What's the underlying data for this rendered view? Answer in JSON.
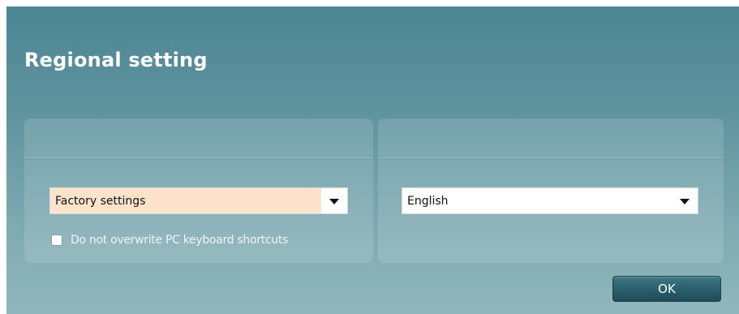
{
  "dialog": {
    "title": "Regional setting"
  },
  "left_panel": {
    "select": {
      "value": "Factory settings",
      "highlight_color": "#fde3cc"
    },
    "checkbox": {
      "label": "Do not overwrite PC keyboard shortcuts",
      "checked": false
    }
  },
  "right_panel": {
    "select": {
      "value": "English"
    }
  },
  "footer": {
    "ok_label": "OK"
  },
  "colors": {
    "dialog_top": "#4d8593",
    "dialog_bottom": "#90b8bc",
    "button": "#2b5f6c"
  }
}
